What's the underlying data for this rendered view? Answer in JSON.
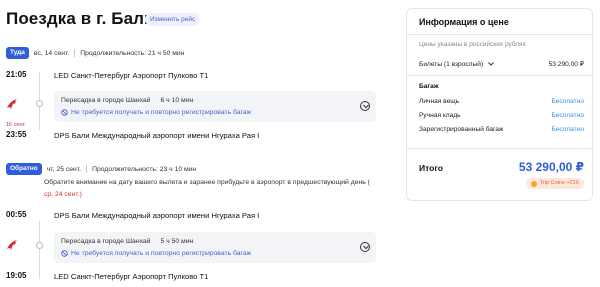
{
  "page": {
    "title": "Поездка в г. Бали",
    "change_flight": "Изменить рейс"
  },
  "outbound": {
    "badge": "Туда",
    "date": "вс, 14 сент.",
    "duration": "Продолжительность: 21 ч 50 мин",
    "dep_time": "21:05",
    "dep_airport": "LED Санкт-Петербург Аэропорт Пулково T1",
    "transfer_city": "Пересадка в городе Шанхай",
    "transfer_duration": "6 ч 10 мин",
    "baggage_note": "Не требуется получать и повторно регистрировать багаж",
    "arr_date_note": "15 сент.",
    "arr_time": "23:55",
    "arr_airport": "DPS Бали Международный аэропорт имени Нгураха Рая I"
  },
  "return": {
    "badge": "Обратно",
    "date": "чт, 25 сент.",
    "duration": "Продолжительность: 23 ч 10 мин",
    "notice": "Обратите внимание на дату вашего вылета и заранее прибудьте в аэропорт в предшествующий день (",
    "notice_date": "ср, 24 сент.)",
    "dep_time": "00:55",
    "dep_airport": "DPS Бали Международный аэропорт имени Нгураха Рая I",
    "transfer_city": "Пересадка в городе Шанхай",
    "transfer_duration": "5 ч 50 мин",
    "baggage_note": "Не требуется получать и повторно регистрировать багаж",
    "arr_time": "19:05",
    "arr_airport": "LED Санкт-Петербург Аэропорт Пулково T1"
  },
  "price_card": {
    "title": "Информация о цене",
    "currency_note": "Цены указаны в российских рублях",
    "tickets_label": "Билеты (1 взрослый)",
    "tickets_price": "53 290,00 ₽",
    "baggage_head": "Багаж",
    "personal_item": "Личная вещь",
    "personal_item_value": "Бесплатно",
    "carry_on": "Ручная кладь",
    "carry_on_value": "Бесплатно",
    "checked": "Зарегистрированный багаж",
    "checked_value": "Бесплатно",
    "total_label": "Итого",
    "total_price": "53 290,00 ₽",
    "coins": "Trip Coins +216"
  },
  "colors": {
    "accent": "#2f5fd6",
    "link": "#3a8de0",
    "warning": "#d0312d",
    "airline_red": "#d32f2f"
  },
  "icons": [
    "airline-logo-icon",
    "no-baggage-icon",
    "chevron-down-icon",
    "coin-icon"
  ]
}
